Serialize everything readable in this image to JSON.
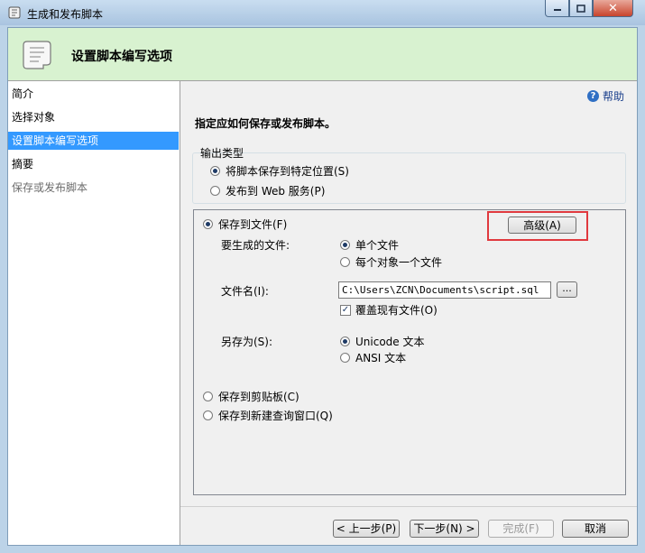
{
  "window": {
    "title": "生成和发布脚本"
  },
  "banner": {
    "title": "设置脚本编写选项"
  },
  "nav": {
    "items": [
      {
        "label": "简介",
        "state": "normal"
      },
      {
        "label": "选择对象",
        "state": "normal"
      },
      {
        "label": "设置脚本编写选项",
        "state": "selected"
      },
      {
        "label": "摘要",
        "state": "normal"
      },
      {
        "label": "保存或发布脚本",
        "state": "disabled"
      }
    ]
  },
  "help": {
    "label": "帮助",
    "icon": "help-icon"
  },
  "main": {
    "heading": "指定应如何保存或发布脚本。",
    "output_type": {
      "label": "输出类型",
      "options": [
        {
          "label": "将脚本保存到特定位置(S)",
          "selected": true
        },
        {
          "label": "发布到 Web 服务(P)",
          "selected": false
        }
      ]
    },
    "save_to_file": {
      "label": "保存到文件(F)",
      "selected": true,
      "advanced_button": "高级(A)",
      "files_to_generate": {
        "label": "要生成的文件:",
        "options": [
          {
            "label": "单个文件",
            "selected": true
          },
          {
            "label": "每个对象一个文件",
            "selected": false
          }
        ]
      },
      "file_name": {
        "label": "文件名(I):",
        "value": "C:\\Users\\ZCN\\Documents\\script.sql",
        "browse_button": "..."
      },
      "overwrite": {
        "label": "覆盖现有文件(O)",
        "checked": true
      },
      "save_as": {
        "label": "另存为(S):",
        "options": [
          {
            "label": "Unicode 文本",
            "selected": true
          },
          {
            "label": "ANSI 文本",
            "selected": false
          }
        ]
      }
    },
    "save_to_clipboard": {
      "label": "保存到剪贴板(C)",
      "selected": false
    },
    "save_to_query_window": {
      "label": "保存到新建查询窗口(Q)",
      "selected": false
    }
  },
  "footer": {
    "prev_button": "< 上一步(P)",
    "next_button": "下一步(N) >",
    "finish_button": "完成(F)",
    "cancel_button": "取消"
  },
  "colors": {
    "banner_bg": "#d8f2d0",
    "selected_nav": "#3399ff",
    "highlight_box": "#e0393e"
  }
}
